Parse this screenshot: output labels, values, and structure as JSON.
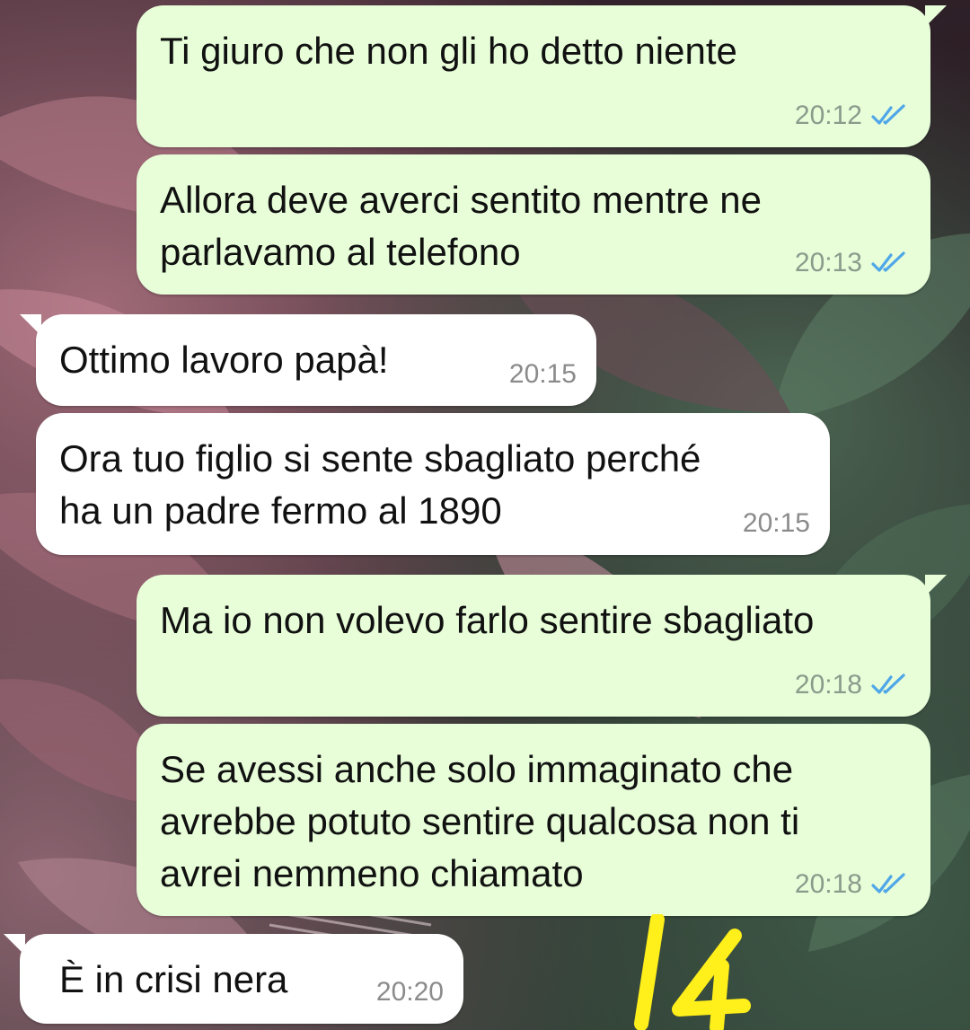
{
  "colors": {
    "outgoing_bubble": "#e7fed8",
    "incoming_bubble": "#ffffff",
    "read_ticks": "#4fa6e8",
    "annotation": "#ffef1a"
  },
  "messages": [
    {
      "direction": "outgoing",
      "text": "Ti giuro che non gli ho detto niente",
      "time": "20:12",
      "status": "read",
      "status_icon": "double-check-icon"
    },
    {
      "direction": "outgoing",
      "text": "Allora deve averci sentito mentre ne\nparlavamo al telefono",
      "time": "20:13",
      "status": "read",
      "status_icon": "double-check-icon"
    },
    {
      "direction": "incoming",
      "text": "Ottimo lavoro papà!",
      "time": "20:15"
    },
    {
      "direction": "incoming",
      "text": "Ora tuo figlio si sente sbagliato perché\nha un padre fermo al 1890",
      "time": "20:15"
    },
    {
      "direction": "outgoing",
      "text": "Ma io non volevo farlo sentire sbagliato",
      "time": "20:18",
      "status": "read",
      "status_icon": "double-check-icon"
    },
    {
      "direction": "outgoing",
      "text": "Se avessi anche solo immaginato che\navrebbe potuto sentire qualcosa non ti\navrei nemmeno chiamato",
      "time": "20:18",
      "status": "read",
      "status_icon": "double-check-icon"
    },
    {
      "direction": "incoming",
      "text": "È in crisi nera",
      "time": "20:20"
    }
  ],
  "annotation": {
    "text": "14",
    "style": "handwritten"
  }
}
